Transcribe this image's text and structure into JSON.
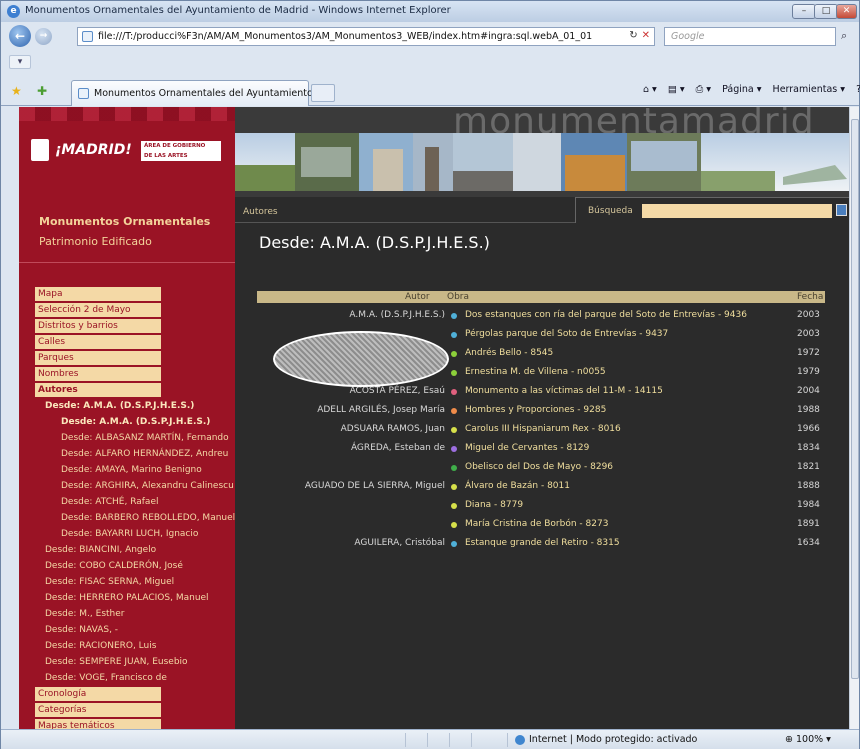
{
  "window": {
    "title": "Monumentos Ornamentales del Ayuntamiento de Madrid - Windows Internet Explorer",
    "min_label": "–",
    "max_label": "□",
    "close_label": "✕"
  },
  "address": {
    "url": "file:///T:/producci%F3n/AM/AM_Monumentos3/AM_Monumentos3_WEB/index.htm#ingra:sql.webA_01_01",
    "refresh_label": "↻",
    "stop_label": "✕",
    "search_placeholder": "Google"
  },
  "tab": {
    "title": "Monumentos Ornamentales del Ayuntamiento d..."
  },
  "commandbar": [
    "Página ▾",
    "Herramientas ▾"
  ],
  "site": {
    "logo_text": "¡MADRID!",
    "area_line1": "ÁREA DE GOBIERNO",
    "area_line2": "DE LAS ARTES",
    "wordmark": "monumentamadrid",
    "section_title": "Monumentos Ornamentales",
    "section_sub": "Patrimonio Edificado",
    "autores_tab": "Autores",
    "search_label": "Búsqueda",
    "page_heading": "Desde: A.M.A. (D.S.P.J.H.E.S.)"
  },
  "menu_top": [
    "Mapa",
    "Selección 2 de Mayo",
    "Distritos y barrios",
    "Calles",
    "Parques",
    "Nombres",
    "Autores"
  ],
  "menu_sub_l1": [
    "Desde: A.M.A. (D.S.P.J.H.E.S.)"
  ],
  "menu_sub_l2": [
    "Desde: A.M.A. (D.S.P.J.H.E.S.)",
    "Desde: ALBASANZ MARTÍN, Fernando",
    "Desde: ALFARO HERNÁNDEZ, Andreu",
    "Desde: AMAYA, Marino Benigno",
    "Desde: ARGHIRA, Alexandru Calinescu",
    "Desde: ATCHÉ, Rafael",
    "Desde: BARBERO REBOLLEDO, Manuel",
    "Desde: BAYARRI LUCH, Ignacio"
  ],
  "menu_sub_l1b": [
    "Desde: BIANCINI, Angelo",
    "Desde: COBO CALDERÓN, José",
    "Desde: FISAC SERNA, Miguel",
    "Desde: HERRERO PALACIOS, Manuel",
    "Desde: M., Esther",
    "Desde: NAVAS, -",
    "Desde: RACIONERO, Luis",
    "Desde: SEMPERE JUAN, Eusebio",
    "Desde: VOGE, Francisco de"
  ],
  "menu_bottom": [
    "Cronología",
    "Categorías",
    "Mapas temáticos"
  ],
  "table": {
    "headers": {
      "autor": "Autor",
      "obra": "Obra",
      "fecha": "Fecha"
    },
    "rows": [
      {
        "autor": "A.M.A. (D.S.P.J.H.E.S.)",
        "obra": "Dos estanques con ría del parque del Soto de Entrevías - 9436",
        "fecha": "2003",
        "dot": "#4fb0d8"
      },
      {
        "autor": "",
        "obra": "Pérgolas parque del Soto de Entrevías - 9437",
        "fecha": "2003",
        "dot": "#4fb0d8"
      },
      {
        "autor": "ABASCAL FUENTES, Juan",
        "obra": "Andrés Bello - 8545",
        "fecha": "1972",
        "dot": "#8ccf3a"
      },
      {
        "autor": "",
        "obra": "Ernestina M. de Villena - n0055",
        "fecha": "1979",
        "dot": "#8ccf3a"
      },
      {
        "autor": "ACOSTA PÉREZ, Esaú",
        "obra": "Monumento a las víctimas del 11-M - 14115",
        "fecha": "2004",
        "dot": "#e0607e"
      },
      {
        "autor": "ADELL ARGILÉS, Josep María",
        "obra": "Hombres y Proporciones - 9285",
        "fecha": "1988",
        "dot": "#f08c4a"
      },
      {
        "autor": "ADSUARA RAMOS, Juan",
        "obra": "Carolus III Hispaniarum Rex - 8016",
        "fecha": "1966",
        "dot": "#d6e04a"
      },
      {
        "autor": "ÁGREDA, Esteban de",
        "obra": "Miguel de Cervantes - 8129",
        "fecha": "1834",
        "dot": "#9d6fe0"
      },
      {
        "autor": "",
        "obra": "Obelisco del Dos de Mayo - 8296",
        "fecha": "1821",
        "dot": "#3fae4a"
      },
      {
        "autor": "AGUADO DE LA SIERRA, Miguel",
        "obra": "Álvaro de Bazán - 8011",
        "fecha": "1888",
        "dot": "#d6e04a"
      },
      {
        "autor": "",
        "obra": "Diana - 8779",
        "fecha": "1984",
        "dot": "#d6e04a"
      },
      {
        "autor": "",
        "obra": "María Cristina de Borbón - 8273",
        "fecha": "1891",
        "dot": "#d6e04a"
      },
      {
        "autor": "AGUILERA, Cristóbal",
        "obra": "Estanque grande del Retiro - 8315",
        "fecha": "1634",
        "dot": "#4fb0d8"
      }
    ]
  },
  "status": {
    "zone": "Internet | Modo protegido: activado",
    "zoom": "100%"
  },
  "colors": {
    "sidebar": "#9a1325",
    "menu_bg": "#f4d9a6",
    "content_bg": "#2b2b2b",
    "link": "#f1df9e"
  }
}
